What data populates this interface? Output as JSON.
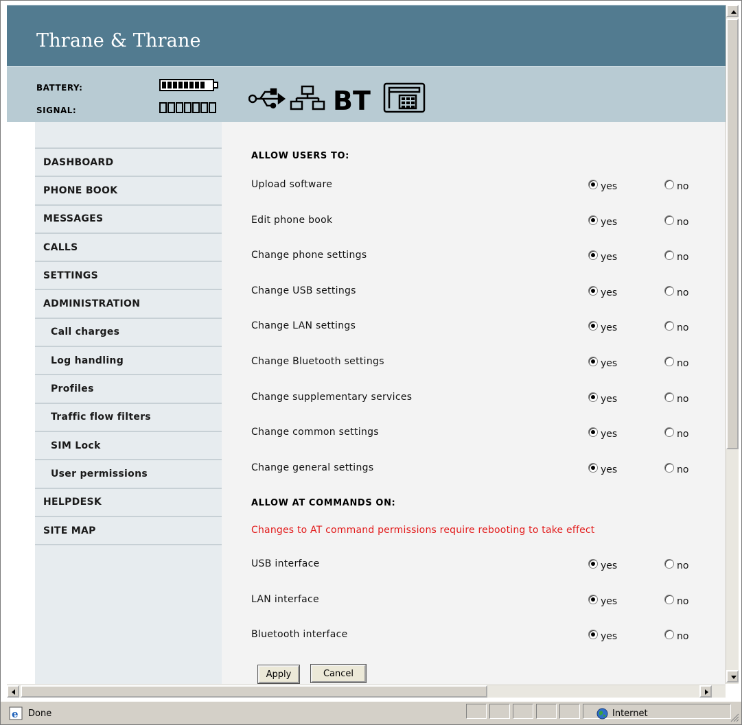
{
  "brand": "Thrane & Thrane",
  "status": {
    "battery_label": "BATTERY:",
    "signal_label": "SIGNAL:",
    "interface_icons": [
      "usb-icon",
      "lan-icon",
      "bluetooth-icon",
      "phone-icon"
    ],
    "bt_text": "BT"
  },
  "nav": {
    "items": [
      {
        "label": "DASHBOARD",
        "sub": false
      },
      {
        "label": "PHONE BOOK",
        "sub": false
      },
      {
        "label": "MESSAGES",
        "sub": false
      },
      {
        "label": "CALLS",
        "sub": false
      },
      {
        "label": "SETTINGS",
        "sub": false
      },
      {
        "label": "ADMINISTRATION",
        "sub": false
      },
      {
        "label": "Call charges",
        "sub": true
      },
      {
        "label": "Log handling",
        "sub": true
      },
      {
        "label": "Profiles",
        "sub": true
      },
      {
        "label": "Traffic flow filters",
        "sub": true
      },
      {
        "label": "SIM Lock",
        "sub": true
      },
      {
        "label": "User permissions",
        "sub": true
      },
      {
        "label": "HELPDESK",
        "sub": false
      },
      {
        "label": "SITE MAP",
        "sub": false
      }
    ]
  },
  "content": {
    "users_title": "ALLOW USERS TO:",
    "yes_label": "yes",
    "no_label": "no",
    "user_permissions": [
      {
        "label": "Upload software",
        "value": "yes"
      },
      {
        "label": "Edit phone book",
        "value": "yes"
      },
      {
        "label": "Change phone settings",
        "value": "yes"
      },
      {
        "label": "Change USB settings",
        "value": "yes"
      },
      {
        "label": "Change LAN settings",
        "value": "yes"
      },
      {
        "label": "Change Bluetooth settings",
        "value": "yes"
      },
      {
        "label": "Change supplementary services",
        "value": "yes"
      },
      {
        "label": "Change common settings",
        "value": "yes"
      },
      {
        "label": "Change general settings",
        "value": "yes"
      }
    ],
    "at_title": "ALLOW AT COMMANDS ON:",
    "at_warning": "Changes to AT command permissions require rebooting to take effect",
    "at_permissions": [
      {
        "label": "USB interface",
        "value": "yes"
      },
      {
        "label": "LAN interface",
        "value": "yes"
      },
      {
        "label": "Bluetooth interface",
        "value": "yes"
      }
    ],
    "apply_label": "Apply",
    "cancel_label": "Cancel"
  },
  "browser": {
    "status_text": "Done",
    "zone_text": "Internet"
  },
  "colors": {
    "header": "#527b90",
    "statusbar": "#b8cbd3",
    "nav_bg": "#e7ecef",
    "warning": "#e21a1a"
  }
}
